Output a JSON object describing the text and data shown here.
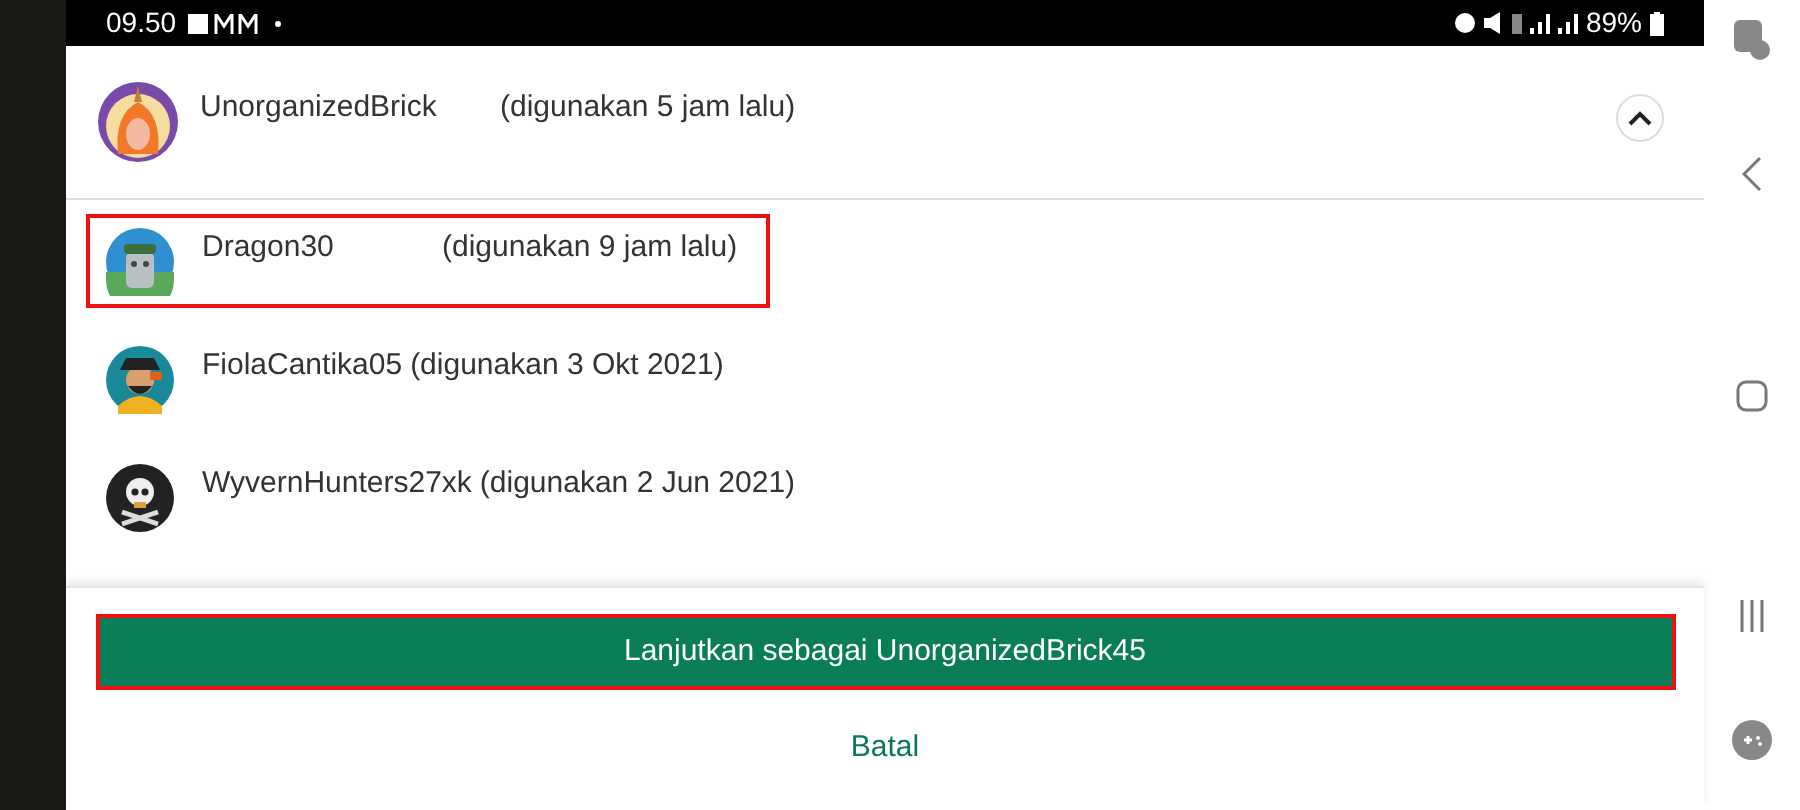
{
  "status_bar": {
    "time": "09.50",
    "battery": "89%"
  },
  "current_account": {
    "name": "UnorganizedBrick",
    "last_used": "(digunakan 5 jam lalu)",
    "expanded": true
  },
  "accounts": [
    {
      "name": "Dragon30",
      "last_used": "(digunakan 9 jam lalu)",
      "highlighted": true,
      "kind": "robot"
    },
    {
      "name": "FiolaCantika05",
      "last_used": "(digunakan 3 Okt 2021)",
      "highlighted": false,
      "kind": "pirate"
    },
    {
      "name": "WyvernHunters27xk",
      "last_used": "(digunakan 2 Jun 2021)",
      "highlighted": false,
      "kind": "skull"
    }
  ],
  "continue_button": {
    "label": "Lanjutkan sebagai UnorganizedBrick45",
    "highlighted": true
  },
  "cancel_button": {
    "label": "Batal"
  }
}
